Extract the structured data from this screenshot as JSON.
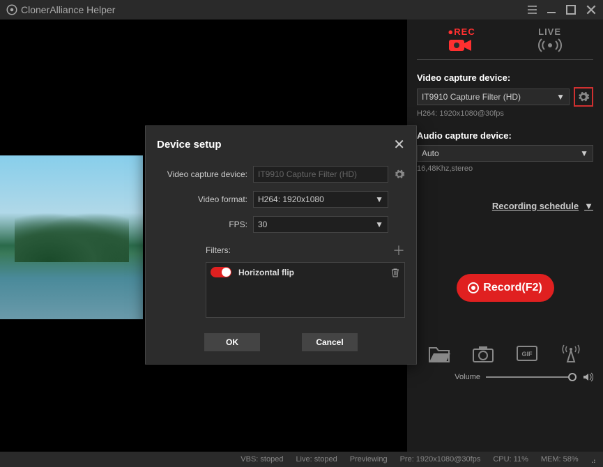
{
  "app": {
    "title": "ClonerAlliance Helper"
  },
  "tabs": {
    "rec": "REC",
    "live": "LIVE"
  },
  "video": {
    "label": "Video capture device:",
    "selected": "IT9910 Capture Filter (HD)",
    "info": "H264: 1920x1080@30fps"
  },
  "audio": {
    "label": "Audio capture device:",
    "selected": "Auto",
    "info": "16,48Khz,stereo"
  },
  "schedule": "Recording schedule",
  "record_btn": "Record(F2)",
  "volume_label": "Volume",
  "status": {
    "vbs": "VBS: stoped",
    "live": "Live: stoped",
    "preview": "Previewing",
    "pre": "Pre: 1920x1080@30fps",
    "cpu": "CPU: 11%",
    "mem": "MEM: 58%"
  },
  "modal": {
    "title": "Device setup",
    "vcd_label": "Video capture device:",
    "vcd_value": "IT9910 Capture Filter (HD)",
    "vf_label": "Video format:",
    "vf_value": "H264: 1920x1080",
    "fps_label": "FPS:",
    "fps_value": "30",
    "filters_label": "Filters:",
    "filter1": "Horizontal flip",
    "ok": "OK",
    "cancel": "Cancel"
  }
}
